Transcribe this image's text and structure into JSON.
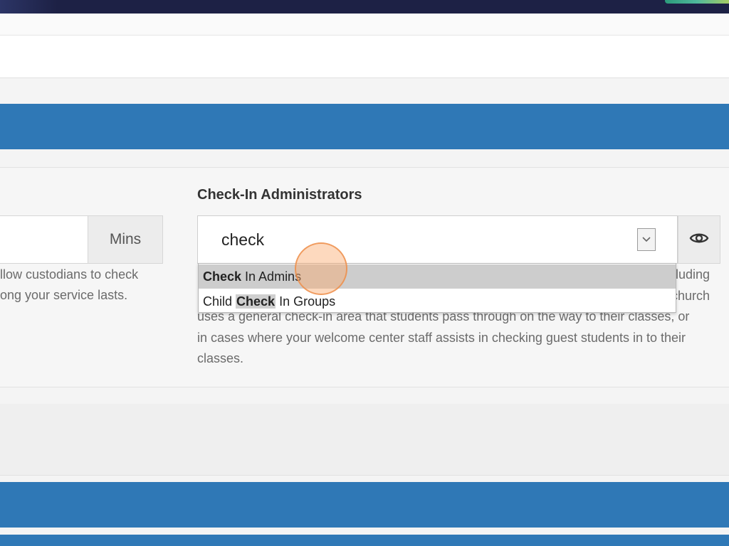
{
  "field": {
    "label": "Check-In Administrators",
    "search_value": "check"
  },
  "options": [
    {
      "match": "Check",
      "rest": " In Admins",
      "prefix": ""
    },
    {
      "prefix": "Child ",
      "match": "Check",
      "rest": " In Groups"
    }
  ],
  "left": {
    "addon": "Mins",
    "help_line1": "llow custodians to check",
    "help_line2": "ong your service lasts."
  },
  "help": {
    "line1_right_a": "luding",
    "line1_right_b": "church",
    "line3": "uses a general check-in area that students pass through on the way to their classes, or",
    "line4": "in cases where your welcome center staff assists in checking guest students in to their",
    "line5": "classes."
  },
  "colors": {
    "blue_band": "#2f78b6",
    "top_bar": "#1d2145"
  },
  "icons": {
    "visibility_button": "eye-icon",
    "select_toggle": "chevron-down-icon"
  }
}
